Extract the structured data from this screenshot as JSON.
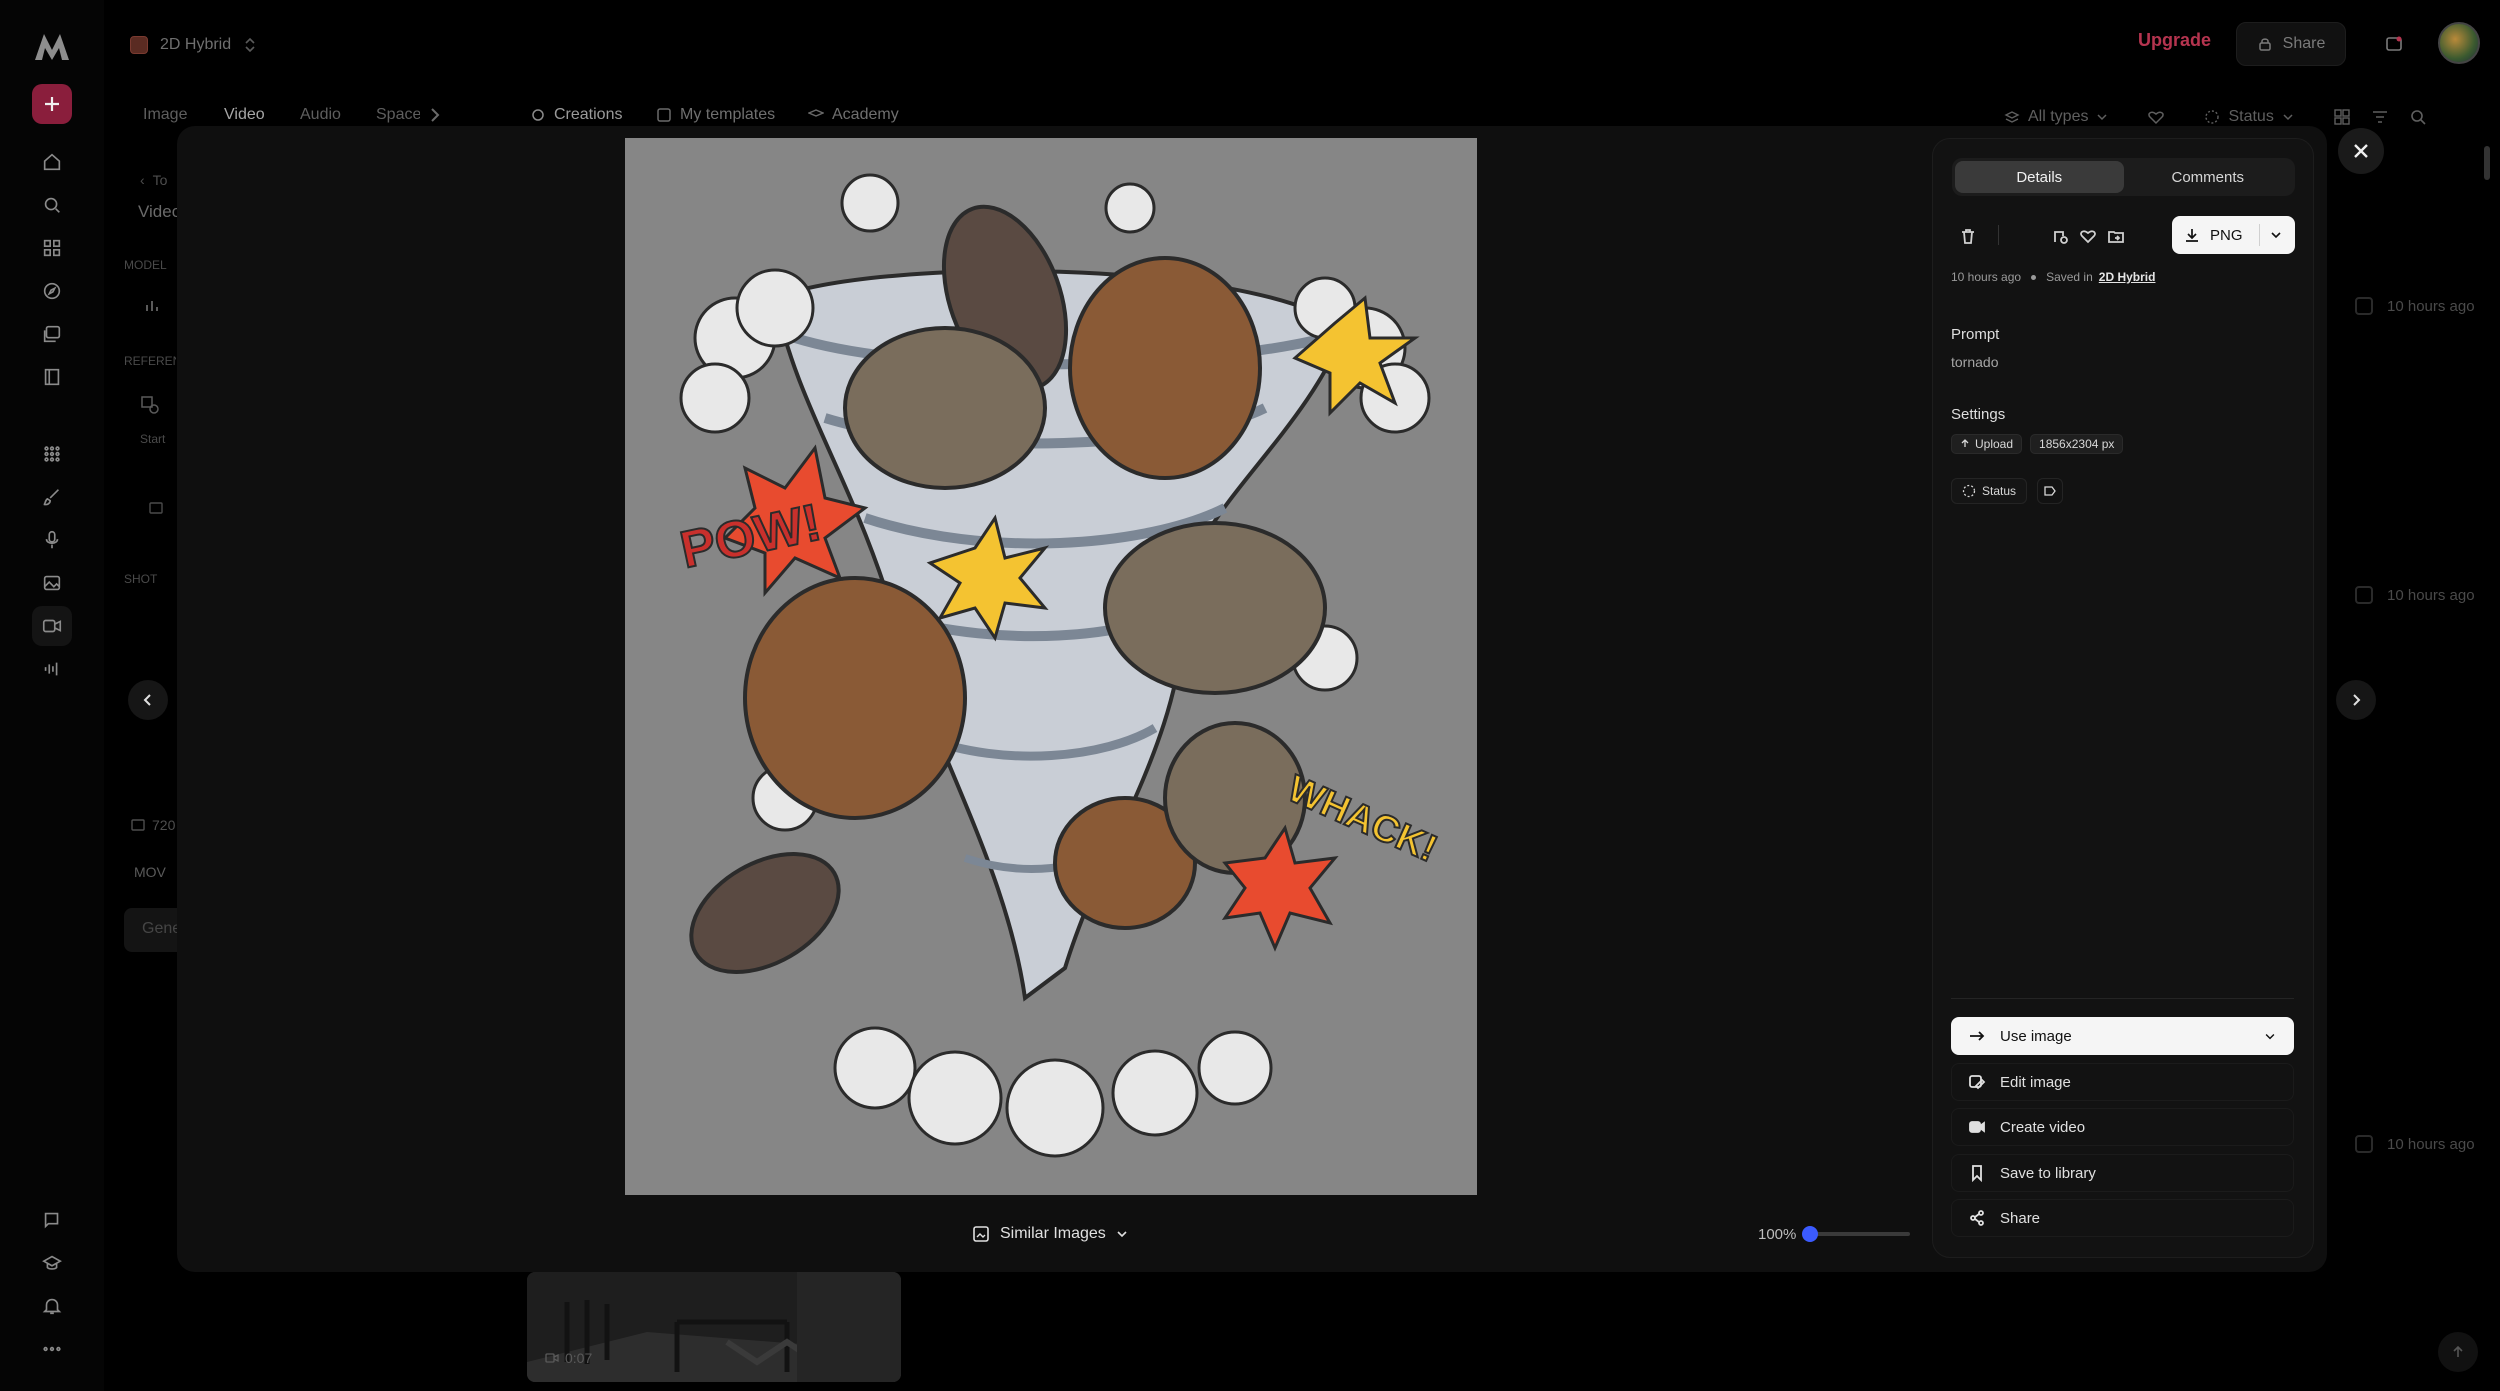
{
  "project": {
    "name": "2D Hybrid"
  },
  "topbar": {
    "upgrade": "Upgrade",
    "share": "Share"
  },
  "media_tabs": [
    "Image",
    "Video",
    "Audio",
    "Spaces"
  ],
  "content_tabs": [
    "Creations",
    "My templates",
    "Academy"
  ],
  "filters": {
    "types": "All types",
    "status": "Status"
  },
  "background": {
    "back_label": "To",
    "section_title": "Video",
    "model_label": "MODEL",
    "reference_label": "REFERENCE",
    "start_label": "Start",
    "shot_label": "SHOT",
    "resolution": "720",
    "format": "MOV",
    "generate": "Gene",
    "timestamps": [
      "10 hours ago",
      "10 hours ago",
      "10 hours ago"
    ],
    "thumb_duration": "0:07"
  },
  "viewer": {
    "similar_images": "Similar Images",
    "zoom": "100%",
    "zoom_fraction": 0.0,
    "image_words": [
      "POW!",
      "WHACK!"
    ]
  },
  "details": {
    "tabs": {
      "details": "Details",
      "comments": "Comments"
    },
    "download_format": "PNG",
    "meta": {
      "time": "10 hours ago",
      "saved_in": "Saved in",
      "location": "2D Hybrid"
    },
    "prompt_title": "Prompt",
    "prompt": "tornado",
    "settings_title": "Settings",
    "chips": {
      "upload": "Upload",
      "size": "1856x2304 px"
    },
    "status": "Status",
    "actions": {
      "use_image": "Use image",
      "edit_image": "Edit image",
      "create_video": "Create video",
      "save_to_library": "Save to library",
      "share": "Share"
    }
  },
  "colors": {
    "accent": "#b5344f",
    "zoom_knob": "#3b5bff",
    "panel": "#121212"
  }
}
